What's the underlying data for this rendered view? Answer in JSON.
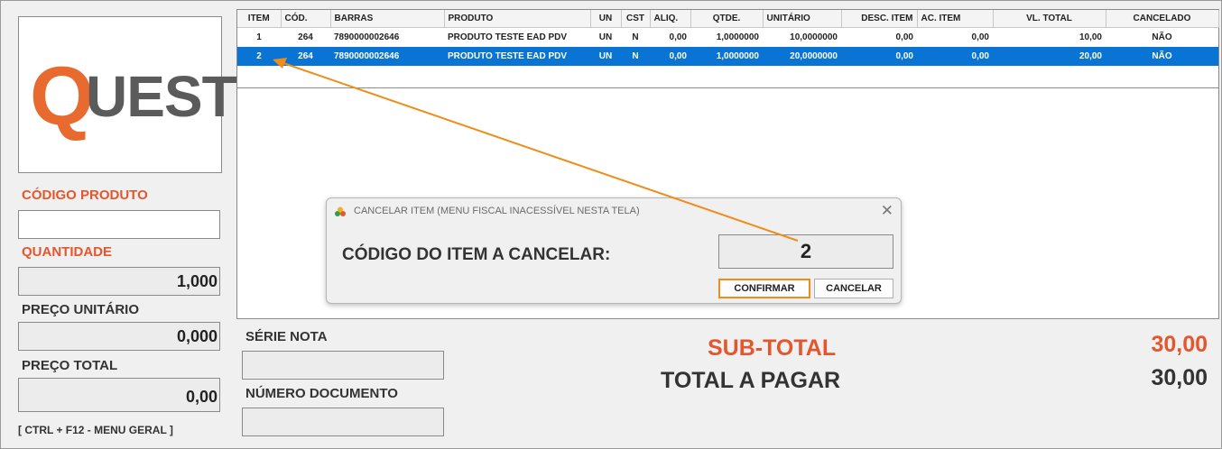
{
  "logo": {
    "first_letter": "Q",
    "rest": "UESTOR",
    "color_accent": "#e96a2e",
    "color_text": "#5b5b5b"
  },
  "left": {
    "codigo_produto_label": "CÓDIGO PRODUTO",
    "codigo_produto_value": "",
    "quantidade_label": "QUANTIDADE",
    "quantidade_value": "1,000",
    "preco_unitario_label": "PREÇO UNITÁRIO",
    "preco_unitario_value": "0,000",
    "preco_total_label": "PREÇO TOTAL",
    "preco_total_value": "0,00",
    "shortcut": "[ CTRL + F12 - MENU GERAL ]"
  },
  "grid": {
    "columns": [
      "ITEM",
      "CÓD.",
      "BARRAS",
      "PRODUTO",
      "UN",
      "CST",
      "ALIQ.",
      "QTDE.",
      "UNITÁRIO",
      "DESC. ITEM",
      "AC. ITEM",
      "VL. TOTAL",
      "CANCELADO"
    ],
    "rows": [
      [
        "1",
        "264",
        "7890000002646",
        "PRODUTO TESTE EAD PDV",
        "UN",
        "N",
        "0,00",
        "1,0000000",
        "10,0000000",
        "0,00",
        "0,00",
        "10,00",
        "NÃO"
      ],
      [
        "2",
        "264",
        "7890000002646",
        "PRODUTO TESTE EAD PDV",
        "UN",
        "N",
        "0,00",
        "1,0000000",
        "20,0000000",
        "0,00",
        "0,00",
        "20,00",
        "NÃO"
      ]
    ],
    "selected_color": "#0a74d4"
  },
  "bottom": {
    "serie_nota_label": "SÉRIE NOTA",
    "numero_documento_label": "NÚMERO DOCUMENTO",
    "subtotal_label": "SUB-TOTAL",
    "subtotal_value": "30,00",
    "total_label": "TOTAL A PAGAR",
    "total_value": "30,00"
  },
  "dialog": {
    "title": "CANCELAR ITEM (MENU FISCAL INACESSÍVEL NESTA TELA)",
    "close_icon": "close-icon",
    "prompt": "CÓDIGO DO ITEM A CANCELAR:",
    "input_value": "2",
    "confirm_label": "CONFIRMAR",
    "cancel_label": "CANCELAR"
  },
  "annotation": {
    "arrow_color": "#f08c1a"
  }
}
